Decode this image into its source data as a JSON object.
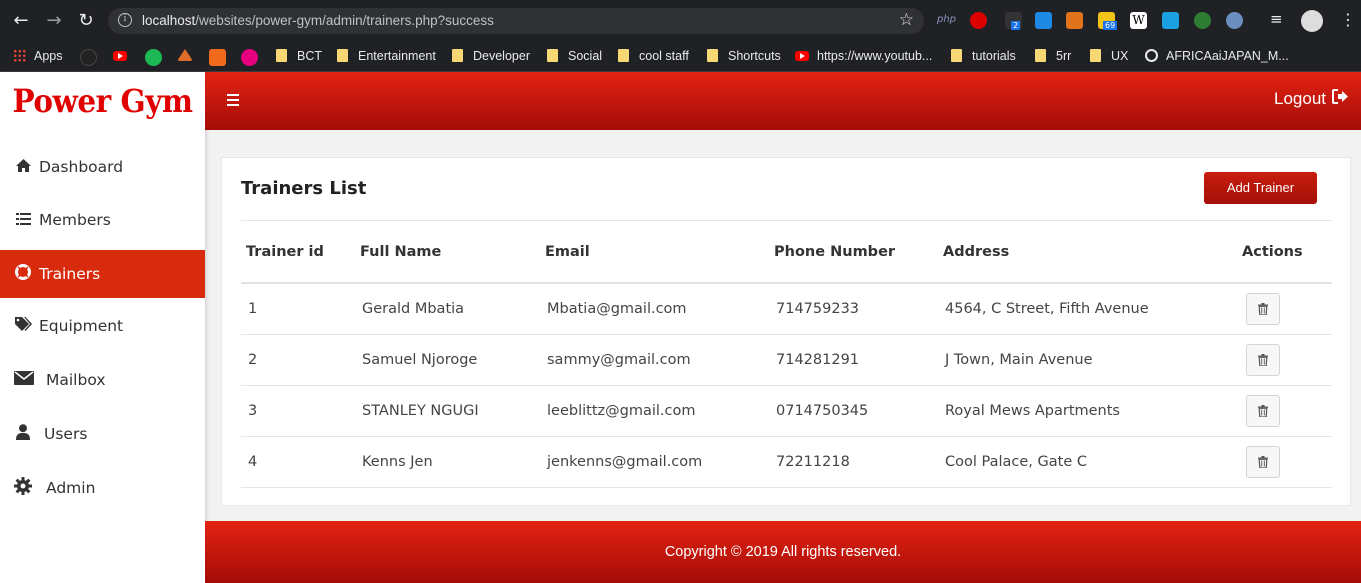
{
  "browser": {
    "url_host": "localhost",
    "url_path": "/websites/power-gym/admin/trainers.php?success",
    "bookmarks": [
      "Apps",
      "BCT",
      "Entertainment",
      "Developer",
      "Social",
      "cool staff",
      "Shortcuts",
      "https://www.youtub...",
      "tutorials",
      "5rr",
      "UX",
      "AFRICAaiJAPAN_M..."
    ],
    "ext_badges": [
      "2",
      "69"
    ],
    "ext_text": "php"
  },
  "app": {
    "logo": "Power Gym",
    "logout_label": "Logout",
    "sidebar": [
      {
        "label": "Dashboard",
        "icon": "home-icon"
      },
      {
        "label": "Members",
        "icon": "list-icon"
      },
      {
        "label": "Trainers",
        "icon": "lifebuoy-icon",
        "active": true
      },
      {
        "label": "Equipment",
        "icon": "tags-icon"
      },
      {
        "label": "Mailbox",
        "icon": "envelope-icon"
      },
      {
        "label": "Users",
        "icon": "user-icon"
      },
      {
        "label": "Admin",
        "icon": "gear-icon"
      }
    ],
    "card_title": "Trainers List",
    "add_button": "Add Trainer",
    "table": {
      "headers": [
        "Trainer id",
        "Full Name",
        "Email",
        "Phone Number",
        "Address",
        "Actions"
      ],
      "rows": [
        [
          "1",
          "Gerald Mbatia",
          "Mbatia@gmail.com",
          "714759233",
          "4564, C Street, Fifth Avenue"
        ],
        [
          "2",
          "Samuel Njoroge",
          "sammy@gmail.com",
          "714281291",
          "J Town, Main Avenue"
        ],
        [
          "3",
          "STANLEY NGUGI",
          "leeblittz@gmail.com",
          "0714750345",
          "Royal Mews Apartments"
        ],
        [
          "4",
          "Kenns Jen",
          "jenkenns@gmail.com",
          "72211218",
          "Cool Palace, Gate C"
        ]
      ]
    },
    "footer": "Copyright © 2019 All rights reserved.",
    "colors": {
      "brand_red": "#d82a0d",
      "topbar_top": "#e32312",
      "topbar_bottom": "#a50c08"
    }
  }
}
